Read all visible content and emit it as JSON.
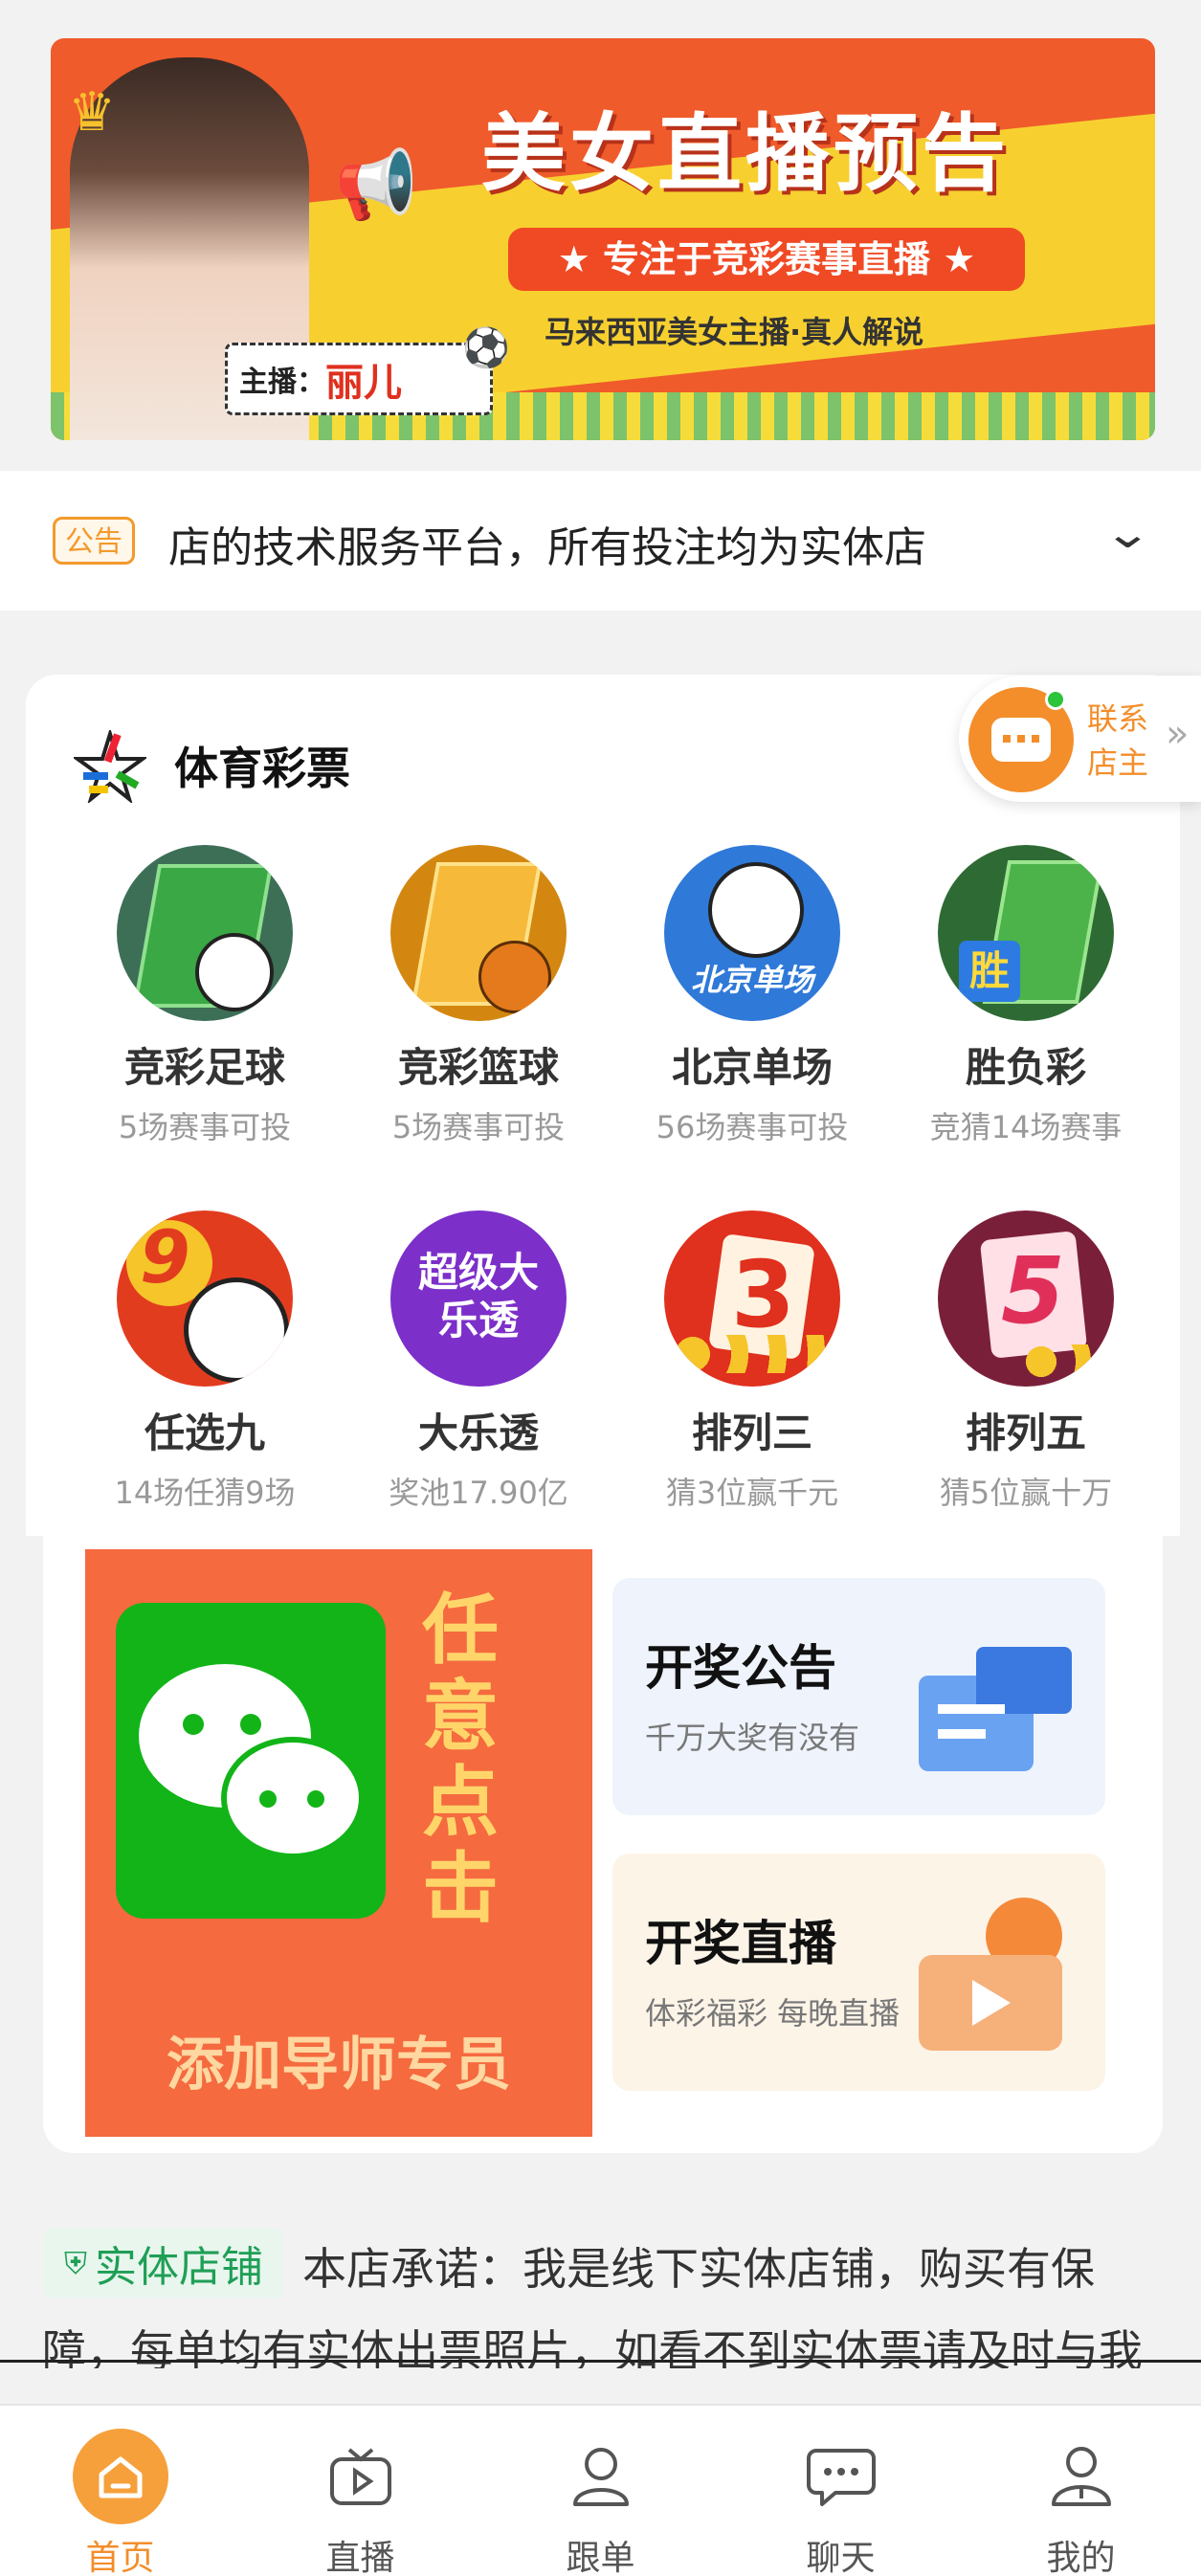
{
  "banner": {
    "title": "美女直播预告",
    "pill": "★ 专注于竞彩赛事直播 ★",
    "subtitle": "马来西亚美女主播·真人解说",
    "host_label": "主播：",
    "host_name": "丽儿"
  },
  "notice": {
    "badge": "公告",
    "text": "店的技术服务平台，所有投注均为实体店"
  },
  "contact": {
    "line1": "联系",
    "line2": "店主"
  },
  "sports": {
    "title": "体育彩票",
    "items": [
      {
        "name": "竞彩足球",
        "sub": "5场赛事可投",
        "icon": "football-field-icon"
      },
      {
        "name": "竞彩篮球",
        "sub": "5场赛事可投",
        "icon": "basketball-court-icon"
      },
      {
        "name": "北京单场",
        "sub": "56场赛事可投",
        "icon": "beijing-single-icon",
        "icon_text": "北京单场"
      },
      {
        "name": "胜负彩",
        "sub": "竞猜14场赛事",
        "icon": "win-lose-icon",
        "icon_text": "胜"
      },
      {
        "name": "任选九",
        "sub": "14场任猜9场",
        "icon": "pick-nine-icon",
        "icon_text": "9"
      },
      {
        "name": "大乐透",
        "sub": "奖池17.90亿",
        "icon": "super-lotto-icon",
        "icon_text": "超级大乐透"
      },
      {
        "name": "排列三",
        "sub": "猜3位赢千元",
        "icon": "pick-three-icon",
        "icon_text": "3"
      },
      {
        "name": "排列五",
        "sub": "猜5位赢十万",
        "icon": "pick-five-icon",
        "icon_text": "5"
      }
    ]
  },
  "promo": {
    "vertical": "任意点击",
    "cta": "添加导师专员",
    "card1": {
      "title": "开奖公告",
      "sub": "千万大奖有没有"
    },
    "card2": {
      "title": "开奖直播",
      "sub": "体彩福彩 每晚直播"
    }
  },
  "shop": {
    "badge": "实体店铺",
    "line1": "本店承诺：我是线下实体店铺，购买有保",
    "line2": "障，每单均有实体出票照片，如看不到实体票请及时与我"
  },
  "tabs": [
    {
      "label": "首页",
      "active": true
    },
    {
      "label": "直播"
    },
    {
      "label": "跟单"
    },
    {
      "label": "聊天"
    },
    {
      "label": "我的"
    }
  ],
  "colors": {
    "accent": "#f5561d",
    "tab_active": "#f6a03b",
    "orange": "#f38e2b"
  }
}
